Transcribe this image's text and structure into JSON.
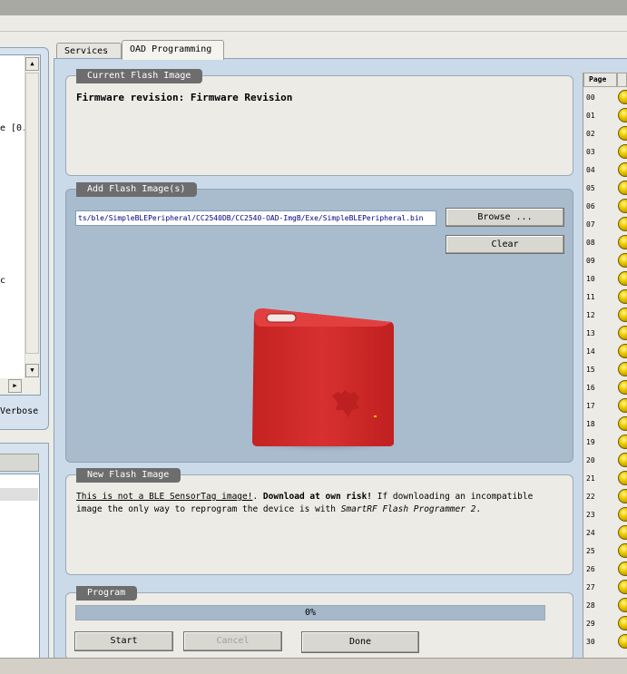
{
  "left_panel": {
    "text_fragment_1": "e [0.",
    "text_fragment_2": "c",
    "verbose_label": "Verbose"
  },
  "tabs": [
    {
      "label": "Services",
      "active": false
    },
    {
      "label": "OAD Programming",
      "active": true
    }
  ],
  "current_flash": {
    "group_label": "Current Flash Image",
    "firmware_line": "Firmware revision: Firmware Revision"
  },
  "add_flash": {
    "group_label": "Add Flash Image(s)",
    "file_path": "ts/ble/SimpleBLEPeripheral/CC2540DB/CC2540-OAD-ImgB/Exe/SimpleBLEPeripheral.bin",
    "browse_label": "Browse ...",
    "clear_label": "Clear"
  },
  "new_flash": {
    "group_label": "New Flash Image",
    "warning_part1": "This is not a BLE SensorTag image!",
    "warning_part2": ". ",
    "warning_part3": "Download at own risk!",
    "warning_part4": " If downloading an incompatible image the only way to reprogram the device is with ",
    "warning_part5": "SmartRF Flash Programmer 2",
    "warning_part6": "."
  },
  "program": {
    "group_label": "Program",
    "progress_text": "0%",
    "progress_value": 0,
    "start_label": "Start",
    "cancel_label": "Cancel",
    "done_label": "Done"
  },
  "pages": {
    "header": "Page",
    "led_color": "#f0d000",
    "rows": [
      "00",
      "01",
      "02",
      "03",
      "04",
      "05",
      "06",
      "07",
      "08",
      "09",
      "10",
      "11",
      "12",
      "13",
      "14",
      "15",
      "16",
      "17",
      "18",
      "19",
      "20",
      "21",
      "22",
      "23",
      "24",
      "25",
      "26",
      "27",
      "28",
      "29",
      "30"
    ]
  },
  "colors": {
    "tab_page": "#cbdae9",
    "add_group": "#a9bccd",
    "group_label_bg": "#6d6d6d",
    "sensortag_red": "#d42a2a"
  }
}
